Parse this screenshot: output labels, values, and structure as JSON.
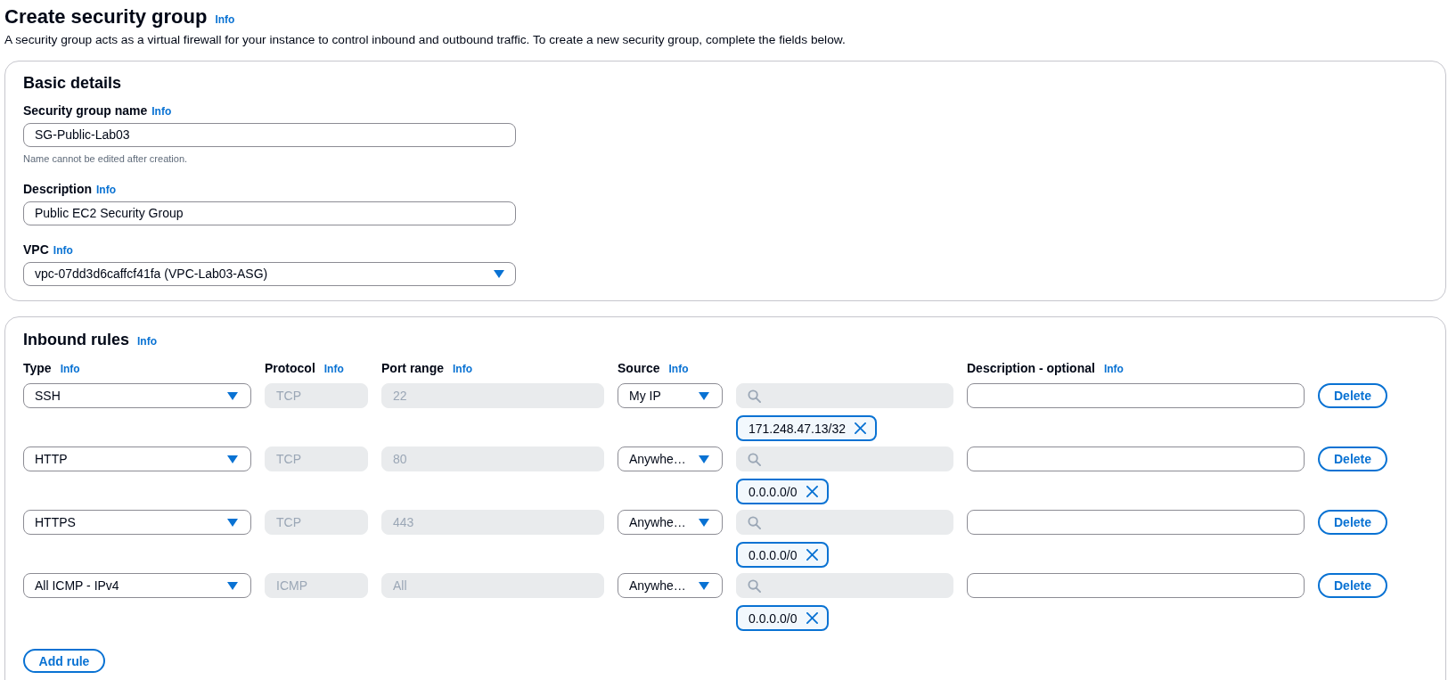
{
  "header": {
    "title": "Create security group",
    "info": "Info",
    "description": "A security group acts as a virtual firewall for your instance to control inbound and outbound traffic. To create a new security group, complete the fields below."
  },
  "basic_details": {
    "title": "Basic details",
    "fields": [
      {
        "kind": "text",
        "label": "Security group name",
        "info": "Info",
        "value": "SG-Public-Lab03",
        "hint": "Name cannot be edited after creation."
      },
      {
        "kind": "text",
        "label": "Description",
        "info": "Info",
        "value": "Public EC2 Security Group"
      },
      {
        "kind": "select",
        "label": "VPC",
        "info": "Info",
        "value": "vpc-07dd3d6caffcf41fa (VPC-Lab03-ASG)"
      }
    ]
  },
  "inbound_rules": {
    "title": "Inbound rules",
    "info": "Info",
    "columns": [
      {
        "label": "Type",
        "info": "Info"
      },
      {
        "label": "Protocol",
        "info": "Info"
      },
      {
        "label": "Port range",
        "info": "Info"
      },
      {
        "label": "Source",
        "info": "Info"
      },
      {
        "label": "Description - optional",
        "info": "Info"
      }
    ],
    "rules": [
      {
        "type": "SSH",
        "protocol": {
          "value": "TCP",
          "disabled": true
        },
        "port_range": {
          "value": "22",
          "disabled": true
        },
        "source": "My IP",
        "search": {
          "disabled": true
        },
        "tokens": [
          "171.248.47.13/32"
        ],
        "delete": "Delete"
      },
      {
        "type": "HTTP",
        "protocol": {
          "value": "TCP",
          "disabled": true
        },
        "port_range": {
          "value": "80",
          "disabled": true
        },
        "source": "Anywhe…",
        "search": {
          "disabled": true
        },
        "tokens": [
          "0.0.0.0/0"
        ],
        "delete": "Delete"
      },
      {
        "type": "HTTPS",
        "protocol": {
          "value": "TCP",
          "disabled": true
        },
        "port_range": {
          "value": "443",
          "disabled": true
        },
        "source": "Anywhe…",
        "search": {
          "disabled": true
        },
        "tokens": [
          "0.0.0.0/0"
        ],
        "delete": "Delete"
      },
      {
        "type": "All ICMP - IPv4",
        "protocol": {
          "value": "ICMP",
          "disabled": true
        },
        "port_range": {
          "value": "All",
          "disabled": true
        },
        "source": "Anywhe…",
        "search": {
          "disabled": true
        },
        "tokens": [
          "0.0.0.0/0"
        ],
        "delete": "Delete"
      }
    ],
    "add_rule": "Add rule"
  }
}
